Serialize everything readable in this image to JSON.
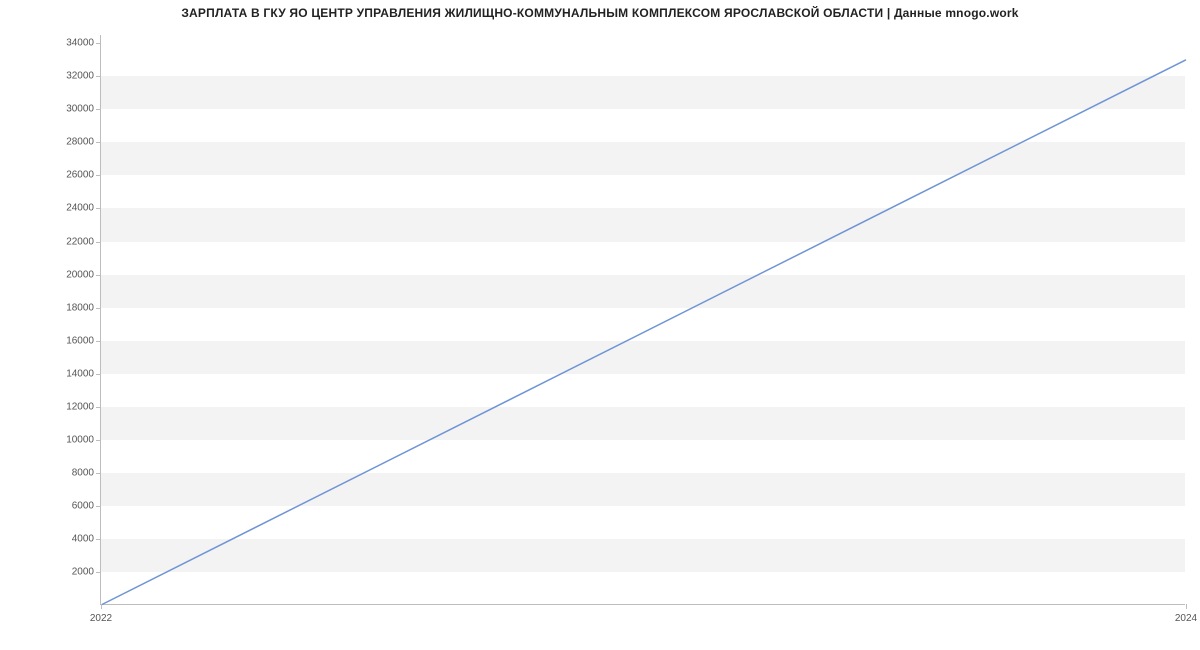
{
  "chart_data": {
    "type": "line",
    "title": "ЗАРПЛАТА В ГКУ ЯО ЦЕНТР УПРАВЛЕНИЯ ЖИЛИЩНО-КОММУНАЛЬНЫМ КОМПЛЕКСОМ ЯРОСЛАВСКОЙ ОБЛАСТИ | Данные mnogo.work",
    "x": [
      2022,
      2024
    ],
    "values": [
      0,
      33000
    ],
    "x_ticks": [
      2022,
      2024
    ],
    "y_ticks": [
      2000,
      4000,
      6000,
      8000,
      10000,
      12000,
      14000,
      16000,
      18000,
      20000,
      22000,
      24000,
      26000,
      28000,
      30000,
      32000,
      34000
    ],
    "xlabel": "",
    "ylabel": "",
    "ylim": [
      0,
      34500
    ],
    "xlim": [
      2022,
      2024
    ],
    "line_color": "#6f94d6"
  }
}
